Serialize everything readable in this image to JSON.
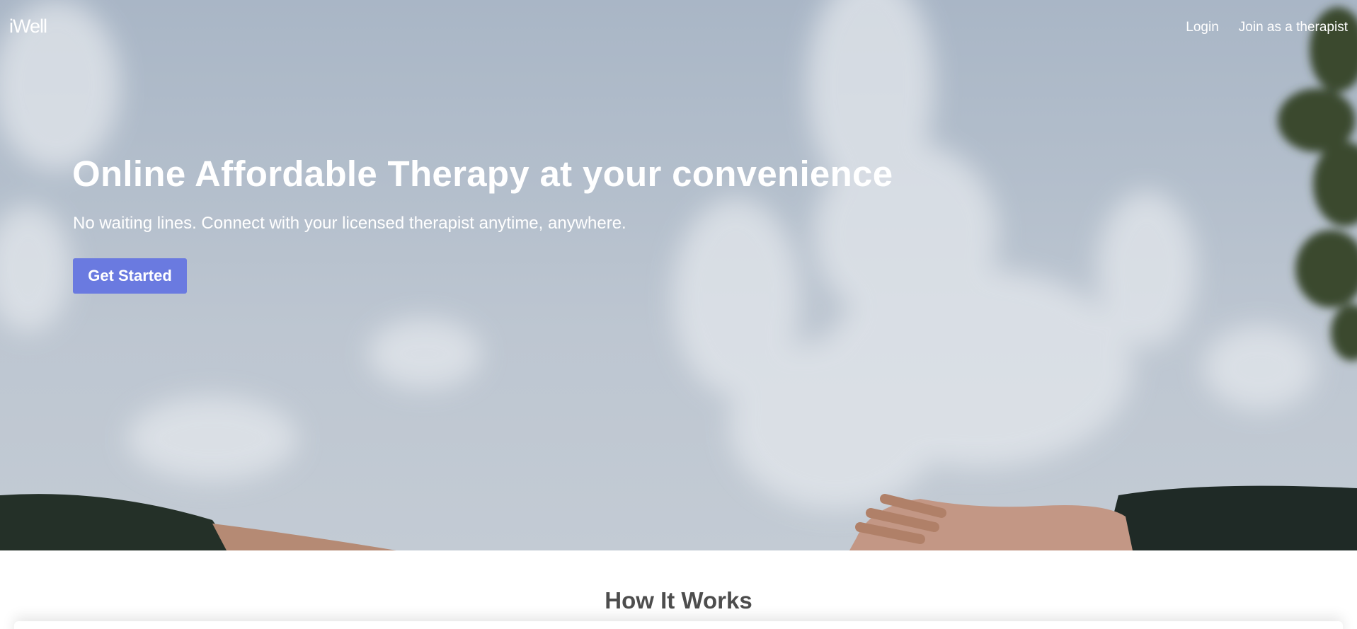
{
  "brand": {
    "logo_text": "iWell"
  },
  "nav": {
    "login_label": "Login",
    "join_label": "Join as a therapist"
  },
  "hero": {
    "title": "Online Affordable Therapy at your convenience",
    "subtitle": "No waiting lines. Connect with your licensed therapist anytime, anywhere.",
    "cta_label": "Get Started",
    "background_image": "sky-clouds-hands-photo"
  },
  "how_it_works": {
    "title": "How It Works"
  },
  "colors": {
    "cta": "#6a7ae0",
    "heading": "#4d4d4d",
    "hero_text": "#ffffff"
  }
}
